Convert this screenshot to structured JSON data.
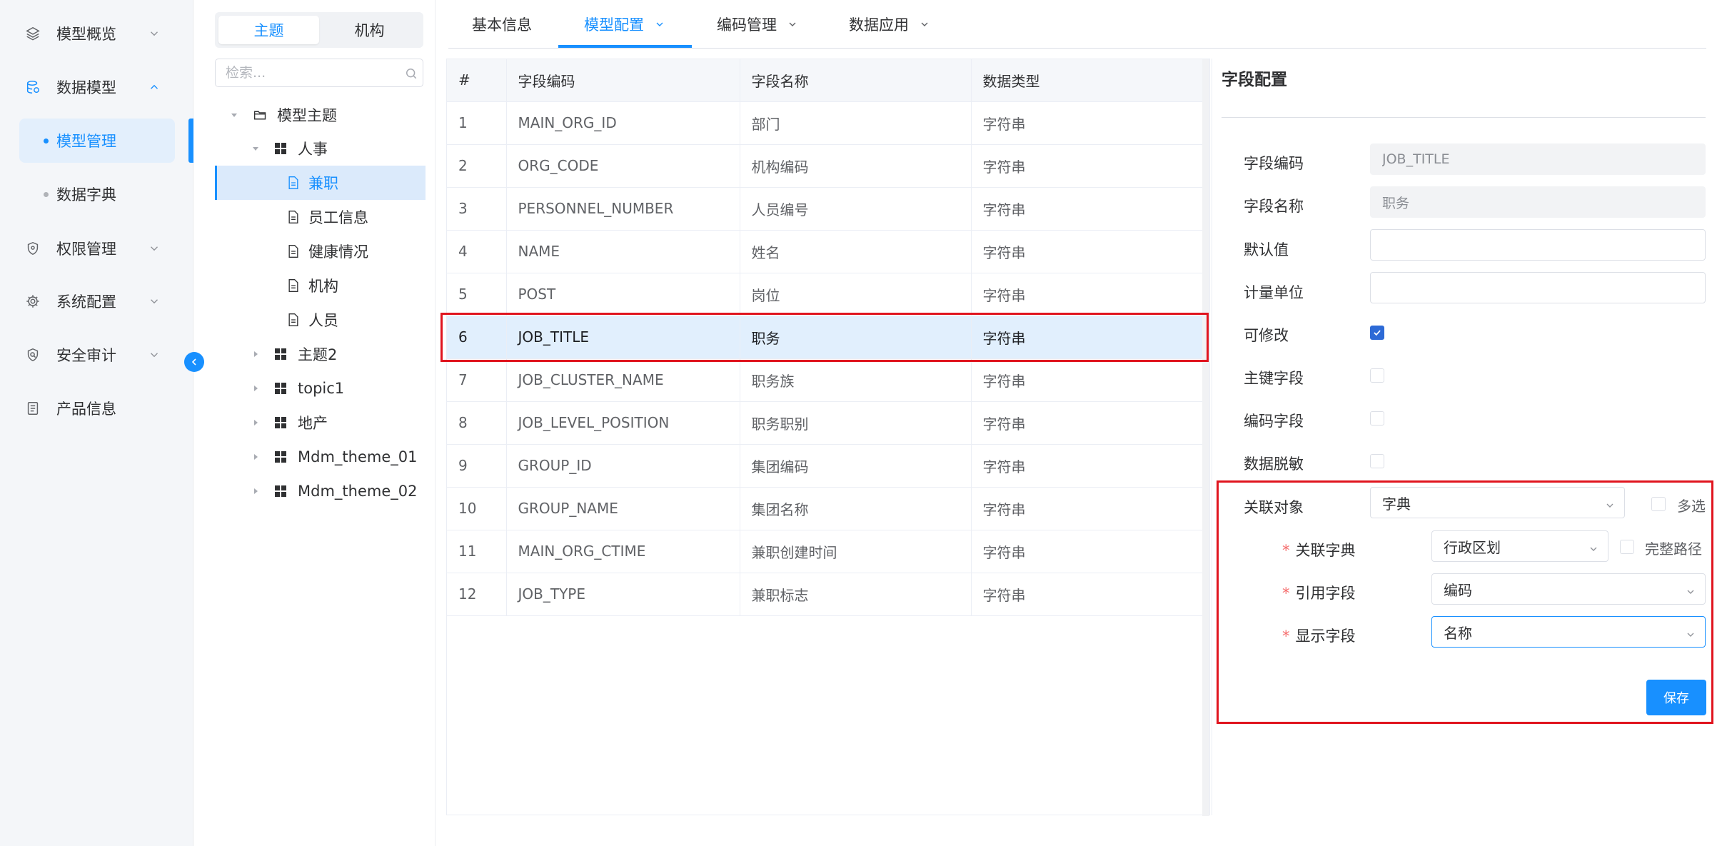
{
  "sidebar": {
    "items": [
      {
        "label": "模型概览"
      },
      {
        "label": "数据模型"
      },
      {
        "label": "权限管理"
      },
      {
        "label": "系统配置"
      },
      {
        "label": "安全审计"
      },
      {
        "label": "产品信息"
      }
    ],
    "subitems": [
      {
        "label": "模型管理"
      },
      {
        "label": "数据字典"
      }
    ]
  },
  "tree": {
    "tabs": [
      "主题",
      "机构"
    ],
    "search_placeholder": "检索...",
    "nodes": [
      {
        "label": "模型主题"
      },
      {
        "label": "人事"
      },
      {
        "label": "兼职"
      },
      {
        "label": "员工信息"
      },
      {
        "label": "健康情况"
      },
      {
        "label": "机构"
      },
      {
        "label": "人员"
      },
      {
        "label": "主题2"
      },
      {
        "label": "topic1"
      },
      {
        "label": "地产"
      },
      {
        "label": "Mdm_theme_01"
      },
      {
        "label": "Mdm_theme_02"
      }
    ]
  },
  "top_tabs": [
    {
      "label": "基本信息"
    },
    {
      "label": "模型配置"
    },
    {
      "label": "编码管理"
    },
    {
      "label": "数据应用"
    }
  ],
  "table": {
    "headers": [
      "#",
      "字段编码",
      "字段名称",
      "数据类型"
    ],
    "rows": [
      {
        "num": "1",
        "code": "MAIN_ORG_ID",
        "name": "部门",
        "type": "字符串"
      },
      {
        "num": "2",
        "code": "ORG_CODE",
        "name": "机构编码",
        "type": "字符串"
      },
      {
        "num": "3",
        "code": "PERSONNEL_NUMBER",
        "name": "人员编号",
        "type": "字符串"
      },
      {
        "num": "4",
        "code": "NAME",
        "name": "姓名",
        "type": "字符串"
      },
      {
        "num": "5",
        "code": "POST",
        "name": "岗位",
        "type": "字符串"
      },
      {
        "num": "6",
        "code": "JOB_TITLE",
        "name": "职务",
        "type": "字符串"
      },
      {
        "num": "7",
        "code": "JOB_CLUSTER_NAME",
        "name": "职务族",
        "type": "字符串"
      },
      {
        "num": "8",
        "code": "JOB_LEVEL_POSITION",
        "name": "职务职别",
        "type": "字符串"
      },
      {
        "num": "9",
        "code": "GROUP_ID",
        "name": "集团编码",
        "type": "字符串"
      },
      {
        "num": "10",
        "code": "GROUP_NAME",
        "name": "集团名称",
        "type": "字符串"
      },
      {
        "num": "11",
        "code": "MAIN_ORG_CTIME",
        "name": "兼职创建时间",
        "type": "字符串"
      },
      {
        "num": "12",
        "code": "JOB_TYPE",
        "name": "兼职标志",
        "type": "字符串"
      }
    ]
  },
  "config": {
    "title": "字段配置",
    "labels": {
      "field_code": "字段编码",
      "field_name": "字段名称",
      "default_value": "默认值",
      "unit": "计量单位",
      "editable": "可修改",
      "primary_key": "主键字段",
      "code_field": "编码字段",
      "masking": "数据脱敏",
      "related_object": "关联对象",
      "multi_select": "多选",
      "related_dict": "关联字典",
      "full_path": "完整路径",
      "ref_field": "引用字段",
      "display_field": "显示字段"
    },
    "values": {
      "field_code": "JOB_TITLE",
      "field_name": "职务",
      "default_value": "",
      "unit": "",
      "related_object": "字典",
      "related_dict": "行政区划",
      "ref_field": "编码",
      "display_field": "名称"
    },
    "save_label": "保存"
  },
  "colors": {
    "accent": "#1890ff",
    "highlight_border": "#e0141e",
    "checkbox_checked": "#2d6ad6",
    "selected_row_bg": "#e1effd"
  },
  "icons": {
    "sidebar": [
      "layers-icon",
      "database-icon",
      "shield-icon",
      "settings-icon",
      "audit-icon",
      "document-icon"
    ]
  }
}
